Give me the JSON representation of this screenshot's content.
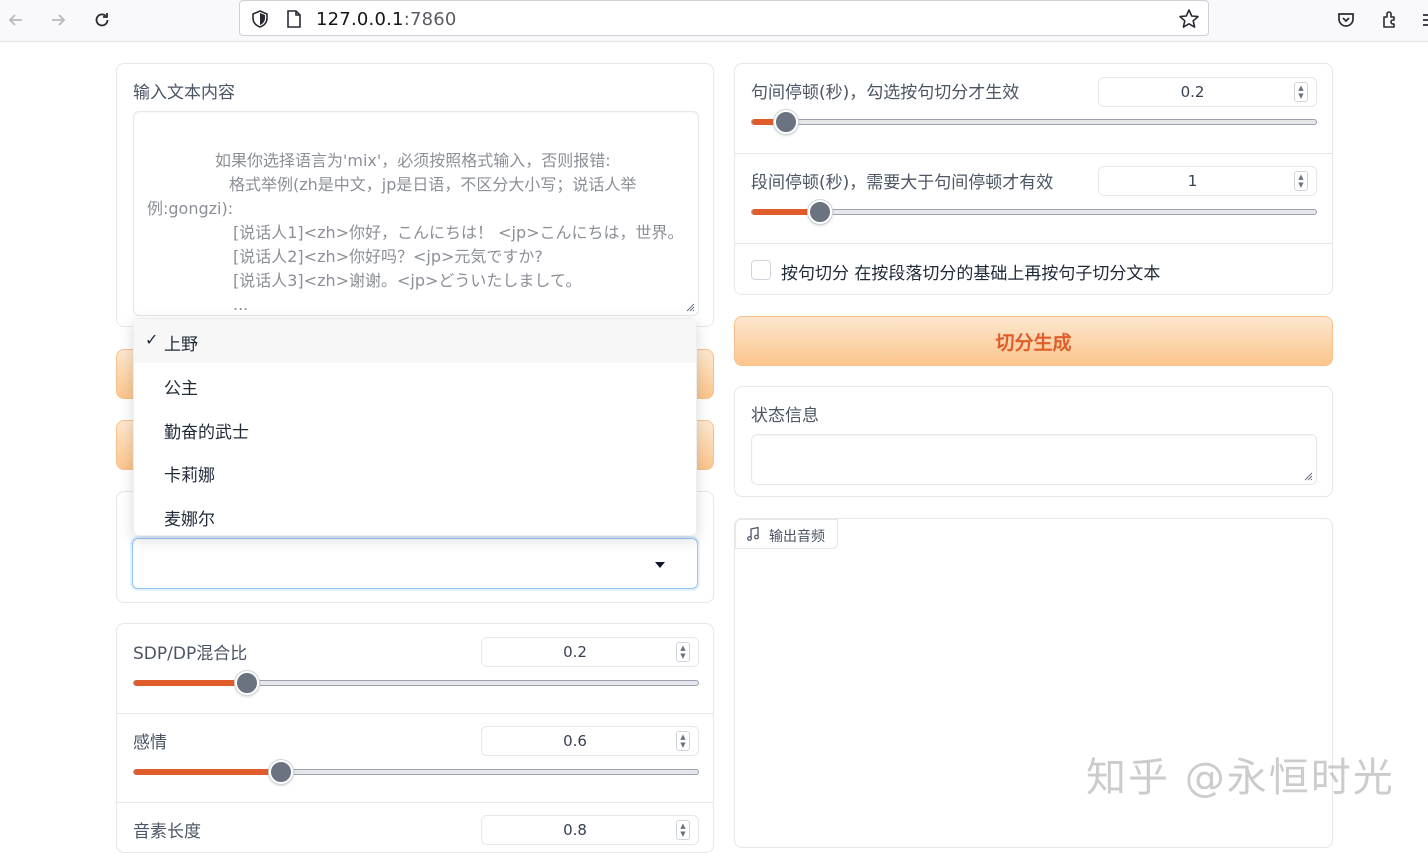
{
  "browser": {
    "url_host": "127.0.0.1",
    "url_port": ":7860"
  },
  "input_panel": {
    "label": "输入文本内容",
    "text_line1": "如果你选择语言为'mix'，必须按照格式输入，否则报错:",
    "text_line2": "格式举例(zh是中文，jp是日语，不区分大小写；说话人举",
    "text_line3": "例:gongzi):",
    "text_line4": "[说话人1]<zh>你好，こんにちは！ <jp>こんにちは，世界。",
    "text_line5": "[说话人2]<zh>你好吗？<jp>元気ですか?",
    "text_line6": "[说话人3]<zh>谢谢。<jp>どういたしまして。",
    "text_line7": "..."
  },
  "speaker_dropdown": {
    "selected_check": "✓",
    "options": [
      "上野",
      "公主",
      "勤奋的武士",
      "卡莉娜",
      "麦娜尔"
    ],
    "value": ""
  },
  "left_sliders": [
    {
      "label": "SDP/DP混合比",
      "value": "0.2",
      "fraction": 0.2
    },
    {
      "label": "感情",
      "value": "0.6",
      "fraction": 0.26
    },
    {
      "label": "音素长度",
      "value": "0.8",
      "fraction": 0.3
    }
  ],
  "right_sliders": [
    {
      "label": "句间停顿(秒)，勾选按句切分才生效",
      "value": "0.2",
      "fraction": 0.06
    },
    {
      "label": "段间停顿(秒)，需要大于句间停顿才有效",
      "value": "1",
      "fraction": 0.12
    }
  ],
  "sentence_split": {
    "label": "按句切分 在按段落切分的基础上再按句子切分文本",
    "checked": false
  },
  "split_button": "切分生成",
  "status": {
    "label": "状态信息",
    "value": ""
  },
  "audio": {
    "tab_label": "输出音频"
  },
  "watermark": "知乎 @永恒时光",
  "colors": {
    "accent": "#e05d2b",
    "button_gradient_top": "#fde7cf",
    "button_gradient_bottom": "#fbc58c"
  }
}
